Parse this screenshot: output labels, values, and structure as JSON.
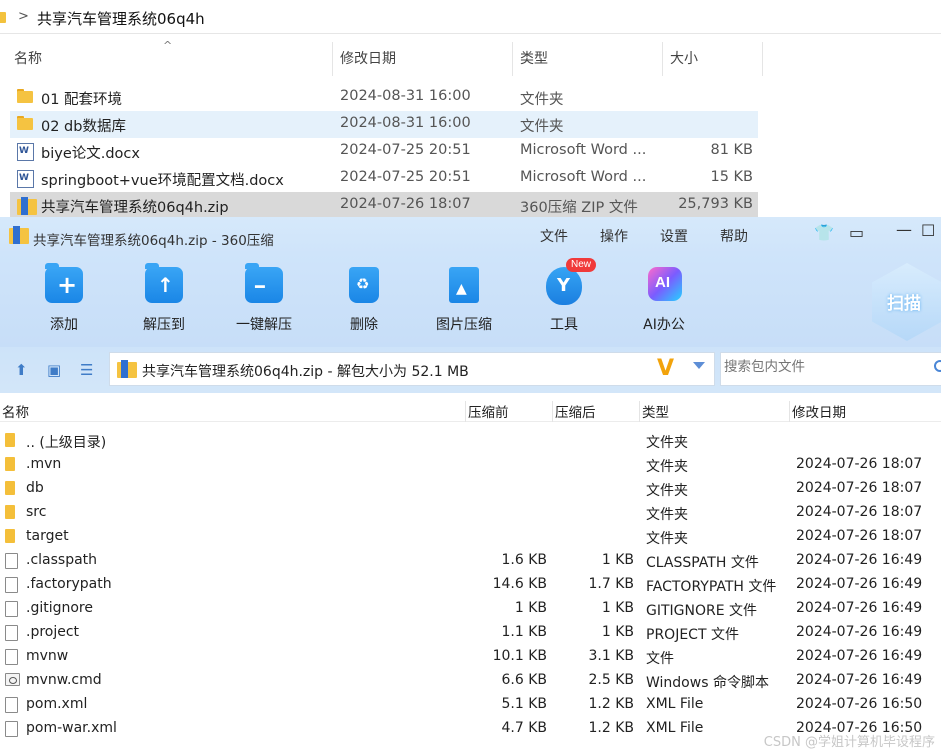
{
  "explorer": {
    "path": "共享汽车管理系统06q4h",
    "columns": {
      "name": "名称",
      "date": "修改日期",
      "type": "类型",
      "size": "大小"
    },
    "rows": [
      {
        "name": "01 配套环境",
        "date": "2024-08-31 16:00",
        "type": "文件夹",
        "size": "",
        "icon": "folder-icon"
      },
      {
        "name": "02 db数据库",
        "date": "2024-08-31 16:00",
        "type": "文件夹",
        "size": "",
        "icon": "folder-icon"
      },
      {
        "name": "biye论文.docx",
        "date": "2024-07-25 20:51",
        "type": "Microsoft Word ...",
        "size": "81 KB",
        "icon": "word-doc-icon"
      },
      {
        "name": "springboot+vue环境配置文档.docx",
        "date": "2024-07-25 20:51",
        "type": "Microsoft Word ...",
        "size": "15 KB",
        "icon": "word-doc-icon"
      },
      {
        "name": "共享汽车管理系统06q4h.zip",
        "date": "2024-07-26 18:07",
        "type": "360压缩 ZIP 文件",
        "size": "25,793 KB",
        "icon": "zip-icon"
      }
    ]
  },
  "window": {
    "title": "共享汽车管理系统06q4h.zip - 360压缩",
    "menu": [
      "文件",
      "操作",
      "设置",
      "帮助"
    ],
    "tools": [
      "添加",
      "解压到",
      "一键解压",
      "删除",
      "图片压缩",
      "工具",
      "AI办公"
    ],
    "new_badge": "New",
    "scan_label": "扫描",
    "path_text": "共享汽车管理系统06q4h.zip - 解包大小为 52.1 MB",
    "search_placeholder": "搜索包内文件",
    "columns": {
      "name": "名称",
      "compressed": "压缩前",
      "uncompressed": "压缩后",
      "type": "类型",
      "date": "修改日期"
    },
    "rows": [
      {
        "name": ".. (上级目录)",
        "before": "",
        "after": "",
        "type": "文件夹",
        "date": "",
        "icon": "folder-icon"
      },
      {
        "name": ".mvn",
        "before": "",
        "after": "",
        "type": "文件夹",
        "date": "2024-07-26 18:07",
        "icon": "folder-icon"
      },
      {
        "name": "db",
        "before": "",
        "after": "",
        "type": "文件夹",
        "date": "2024-07-26 18:07",
        "icon": "folder-icon"
      },
      {
        "name": "src",
        "before": "",
        "after": "",
        "type": "文件夹",
        "date": "2024-07-26 18:07",
        "icon": "folder-icon"
      },
      {
        "name": "target",
        "before": "",
        "after": "",
        "type": "文件夹",
        "date": "2024-07-26 18:07",
        "icon": "folder-icon"
      },
      {
        "name": ".classpath",
        "before": "1.6 KB",
        "after": "1 KB",
        "type": "CLASSPATH 文件",
        "date": "2024-07-26 16:49",
        "icon": "file-icon"
      },
      {
        "name": ".factorypath",
        "before": "14.6 KB",
        "after": "1.7 KB",
        "type": "FACTORYPATH 文件",
        "date": "2024-07-26 16:49",
        "icon": "file-icon"
      },
      {
        "name": ".gitignore",
        "before": "1 KB",
        "after": "1 KB",
        "type": "GITIGNORE 文件",
        "date": "2024-07-26 16:49",
        "icon": "file-icon"
      },
      {
        "name": ".project",
        "before": "1.1 KB",
        "after": "1 KB",
        "type": "PROJECT 文件",
        "date": "2024-07-26 16:49",
        "icon": "file-icon"
      },
      {
        "name": "mvnw",
        "before": "10.1 KB",
        "after": "3.1 KB",
        "type": "文件",
        "date": "2024-07-26 16:49",
        "icon": "file-icon"
      },
      {
        "name": "mvnw.cmd",
        "before": "6.6 KB",
        "after": "2.5 KB",
        "type": "Windows 命令脚本",
        "date": "2024-07-26 16:49",
        "icon": "cmd-file-icon"
      },
      {
        "name": "pom.xml",
        "before": "5.1 KB",
        "after": "1.2 KB",
        "type": "XML File",
        "date": "2024-07-26 16:50",
        "icon": "file-icon"
      },
      {
        "name": "pom-war.xml",
        "before": "4.7 KB",
        "after": "1.2 KB",
        "type": "XML File",
        "date": "2024-07-26 16:50",
        "icon": "file-icon"
      }
    ]
  },
  "watermark": "CSDN @学姐计算机毕设程序"
}
